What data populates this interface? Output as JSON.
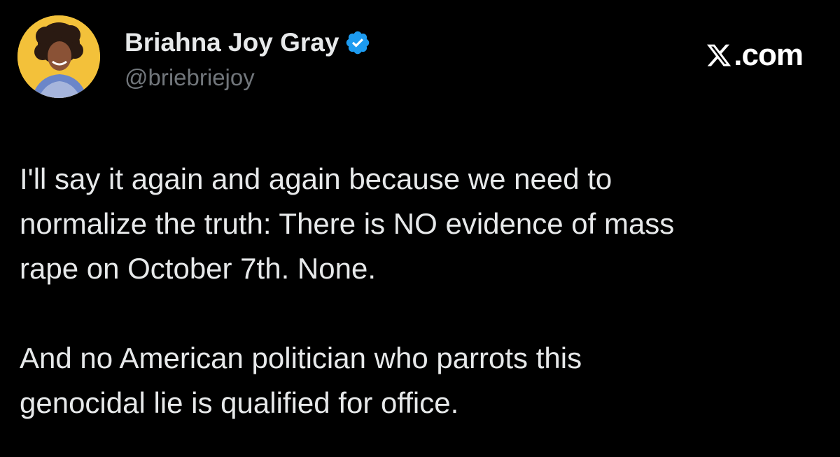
{
  "author": {
    "display_name": "Briahna Joy Gray",
    "handle": "@briebriejoy",
    "verified_icon": "verified-badge-icon",
    "avatar_icon": "profile-photo"
  },
  "brand": {
    "icon": "x-logo-icon",
    "text": ".com"
  },
  "tweet": {
    "paragraph_1": "I'll say it again and again because we need to\nnormalize the truth: There is NO evidence of mass\nrape on October 7th. None.",
    "paragraph_2": "And no American politician who parrots this\ngenocidal lie is qualified for office."
  },
  "colors": {
    "background": "#000000",
    "text": "#e7e9ea",
    "secondary_text": "#71767b",
    "verified_blue": "#1d9bf0",
    "avatar_bg": "#f3c13a"
  }
}
